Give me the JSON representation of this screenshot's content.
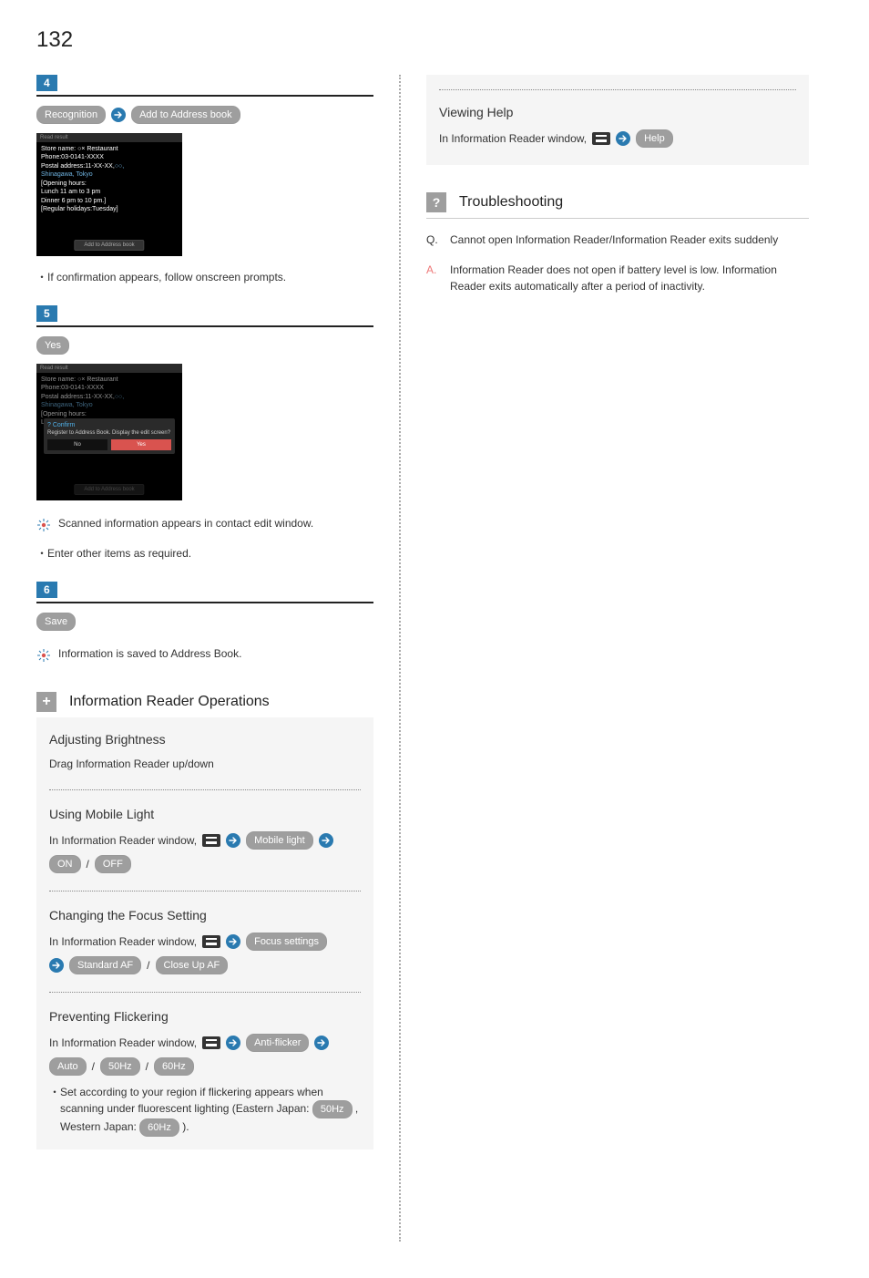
{
  "page_number": "132",
  "left": {
    "step4": {
      "badge": "4",
      "recognition": "Recognition",
      "add_to_ab": "Add to Address book",
      "shot": {
        "header": "Read result",
        "l1": "Store name: ○× Restaurant",
        "l2": "Phone:03-0141-XXXX",
        "l3a": "Postal address:11-XX-XX,",
        "l3b": "○○,",
        "l4": "Shinagawa, Tokyo",
        "l5": "[Opening hours:",
        "l6": "Lunch 11 am to 3 pm",
        "l7": "Dinner 6 pm to 10 pm.]",
        "l8": "[Regular holidays:Tuesday]",
        "btn": "Add to Address book"
      },
      "bullet": "If confirmation appears, follow onscreen prompts."
    },
    "step5": {
      "badge": "5",
      "yes": "Yes",
      "shot": {
        "header": "Read result",
        "l1": "Store name: ○× Restaurant",
        "l2": "Phone:03-0141-XXXX",
        "l3a": "Postal address:11-XX-XX,",
        "l3b": "○○,",
        "l4": "Shinagawa, Tokyo",
        "l5": "[Opening hours:",
        "l6": "Lunch 11 am to 3 pm",
        "dialog_title": "Confirm",
        "dialog_text": "Register to Address Book. Display the edit screen?",
        "no": "No",
        "yes": "Yes",
        "btn": "Add to Address book"
      },
      "note": "Scanned information appears in contact edit window.",
      "bullet": "Enter other items as required."
    },
    "step6": {
      "badge": "6",
      "save": "Save",
      "note": "Information is saved to Address Book."
    },
    "ops": {
      "title": "Information Reader Operations",
      "adjust": {
        "head": "Adjusting Brightness",
        "body": "Drag Information Reader up/down"
      },
      "mobile_light": {
        "head": "Using Mobile Light",
        "prefix": "In Information Reader window, ",
        "ml": "Mobile light",
        "on": "ON",
        "off": "OFF"
      },
      "focus": {
        "head": "Changing the Focus Setting",
        "prefix": "In Information Reader window, ",
        "fs": "Focus settings",
        "std": "Standard AF",
        "close": "Close Up AF"
      },
      "flicker": {
        "head": "Preventing Flickering",
        "prefix": "In Information Reader window, ",
        "af": "Anti-flicker",
        "auto": "Auto",
        "f50": "50Hz",
        "f60": "60Hz",
        "bullet_a": "Set according to your region if flickering appears when scanning under fluorescent lighting (Eastern Japan: ",
        "bullet_b": " , Western Japan: ",
        "bullet_c": " )."
      }
    }
  },
  "right": {
    "viewing_help": {
      "head": "Viewing Help",
      "prefix": "In Information Reader window, ",
      "help": "Help"
    },
    "trouble": {
      "title": "Troubleshooting",
      "q": "Cannot open Information Reader/Information Reader exits suddenly",
      "a": "Information Reader does not open if battery level is low. Information Reader exits automatically after a period of inactivity."
    }
  }
}
